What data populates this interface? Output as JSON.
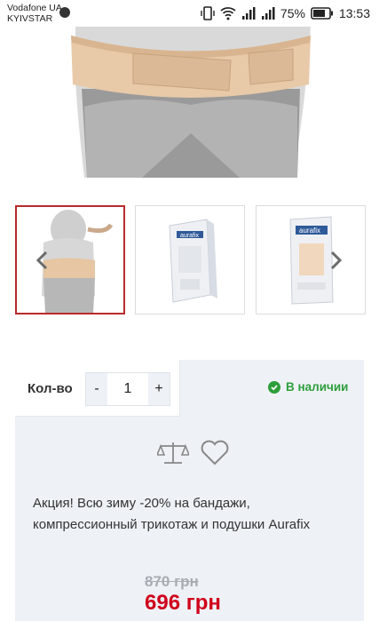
{
  "status_bar": {
    "carrier_line1": "Vodafone UA",
    "carrier_line2": "KYIVSTAR",
    "battery": "75%",
    "time": "13:53"
  },
  "gallery": {
    "thumbnails": [
      {
        "label": "",
        "active": true
      },
      {
        "label": "aurafix",
        "active": false
      },
      {
        "label": "aurafix",
        "active": false
      }
    ]
  },
  "purchase": {
    "qty_label": "Кол-во",
    "decrement": "-",
    "quantity": "1",
    "increment": "+",
    "stock_status": "В наличии"
  },
  "promo_text": "Акция! Всю зиму -20% на бандажи, компрессионный трикотаж и подушки Aurafix",
  "price": {
    "old": "870 грн",
    "new": "696 грн"
  },
  "colors": {
    "accent": "#b82b2b",
    "price": "#d0021b",
    "stock": "#2e9e3b",
    "panel_bg": "#eef2f6"
  }
}
